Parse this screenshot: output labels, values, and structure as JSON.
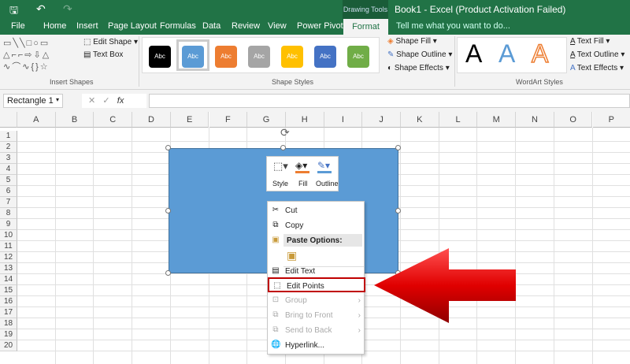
{
  "title_bar": {
    "contextual": "Drawing Tools",
    "title": "Book1 - Excel (Product Activation Failed)"
  },
  "tabs": [
    "File",
    "Home",
    "Insert",
    "Page Layout",
    "Formulas",
    "Data",
    "Review",
    "View",
    "Power Pivot",
    "Format"
  ],
  "tell_me": "Tell me what you want to do...",
  "ribbon": {
    "insert_shapes": {
      "label": "Insert Shapes",
      "edit_shape": "Edit Shape",
      "text_box": "Text Box"
    },
    "shape_styles": {
      "label": "Shape Styles",
      "swatch_text": "Abc",
      "swatches": [
        "#000000",
        "#5b9bd5",
        "#ed7d31",
        "#a5a5a5",
        "#ffc000",
        "#4472c4",
        "#70ad47"
      ],
      "shape_fill": "Shape Fill",
      "shape_outline": "Shape Outline",
      "shape_effects": "Shape Effects"
    },
    "wordart": {
      "label": "WordArt Styles",
      "letter": "A",
      "text_fill": "Text Fill",
      "text_outline": "Text Outline",
      "text_effects": "Text Effects"
    }
  },
  "formula_bar": {
    "name_box": "Rectangle 1",
    "fx": "fx",
    "value": ""
  },
  "columns": [
    "A",
    "B",
    "C",
    "D",
    "E",
    "F",
    "G",
    "H",
    "I",
    "J",
    "K",
    "L",
    "M",
    "N",
    "O",
    "P"
  ],
  "rows": [
    "1",
    "2",
    "3",
    "4",
    "5",
    "6",
    "7",
    "8",
    "9",
    "10",
    "11",
    "12",
    "13",
    "14",
    "15",
    "16",
    "17",
    "18",
    "19",
    "20"
  ],
  "mini_toolbar": {
    "style": "Style",
    "fill": "Fill",
    "outline": "Outline"
  },
  "context_menu": {
    "cut": "Cut",
    "copy": "Copy",
    "paste_options": "Paste Options:",
    "edit_text": "Edit Text",
    "edit_points": "Edit Points",
    "group": "Group",
    "bring_to_front": "Bring to Front",
    "send_to_back": "Send to Back",
    "hyperlink": "Hyperlink..."
  },
  "colors": {
    "excel_green": "#217346",
    "shape_fill": "#5b9bd5",
    "highlight": "#c00000",
    "arrow": "#e00000"
  }
}
